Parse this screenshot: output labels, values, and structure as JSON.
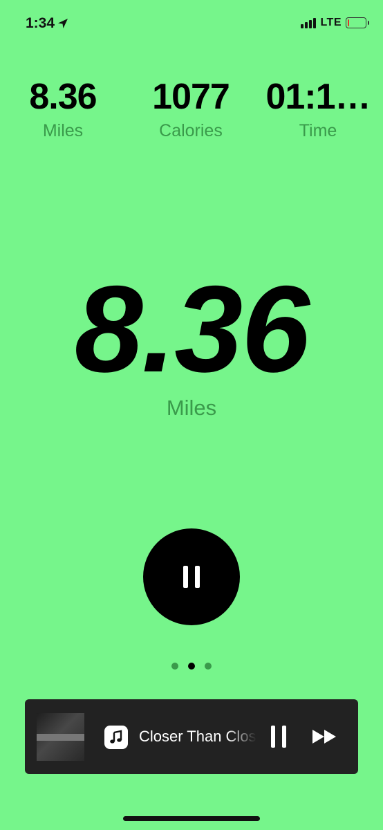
{
  "status_bar": {
    "time": "1:34",
    "network": "LTE",
    "battery_level": 0.1
  },
  "stats": {
    "miles_value": "8.36",
    "miles_label": "Miles",
    "calories_value": "1077",
    "calories_label": "Calories",
    "time_value": "01:1…",
    "time_label": "Time"
  },
  "main_metric": {
    "value": "8.36",
    "label": "Miles"
  },
  "page_indicator": {
    "count": 3,
    "active_index": 1
  },
  "now_playing": {
    "track_title": "Closer Than Close"
  },
  "colors": {
    "background": "#76f58b",
    "label_green": "#3a9a4b",
    "music_bar": "#222222"
  }
}
